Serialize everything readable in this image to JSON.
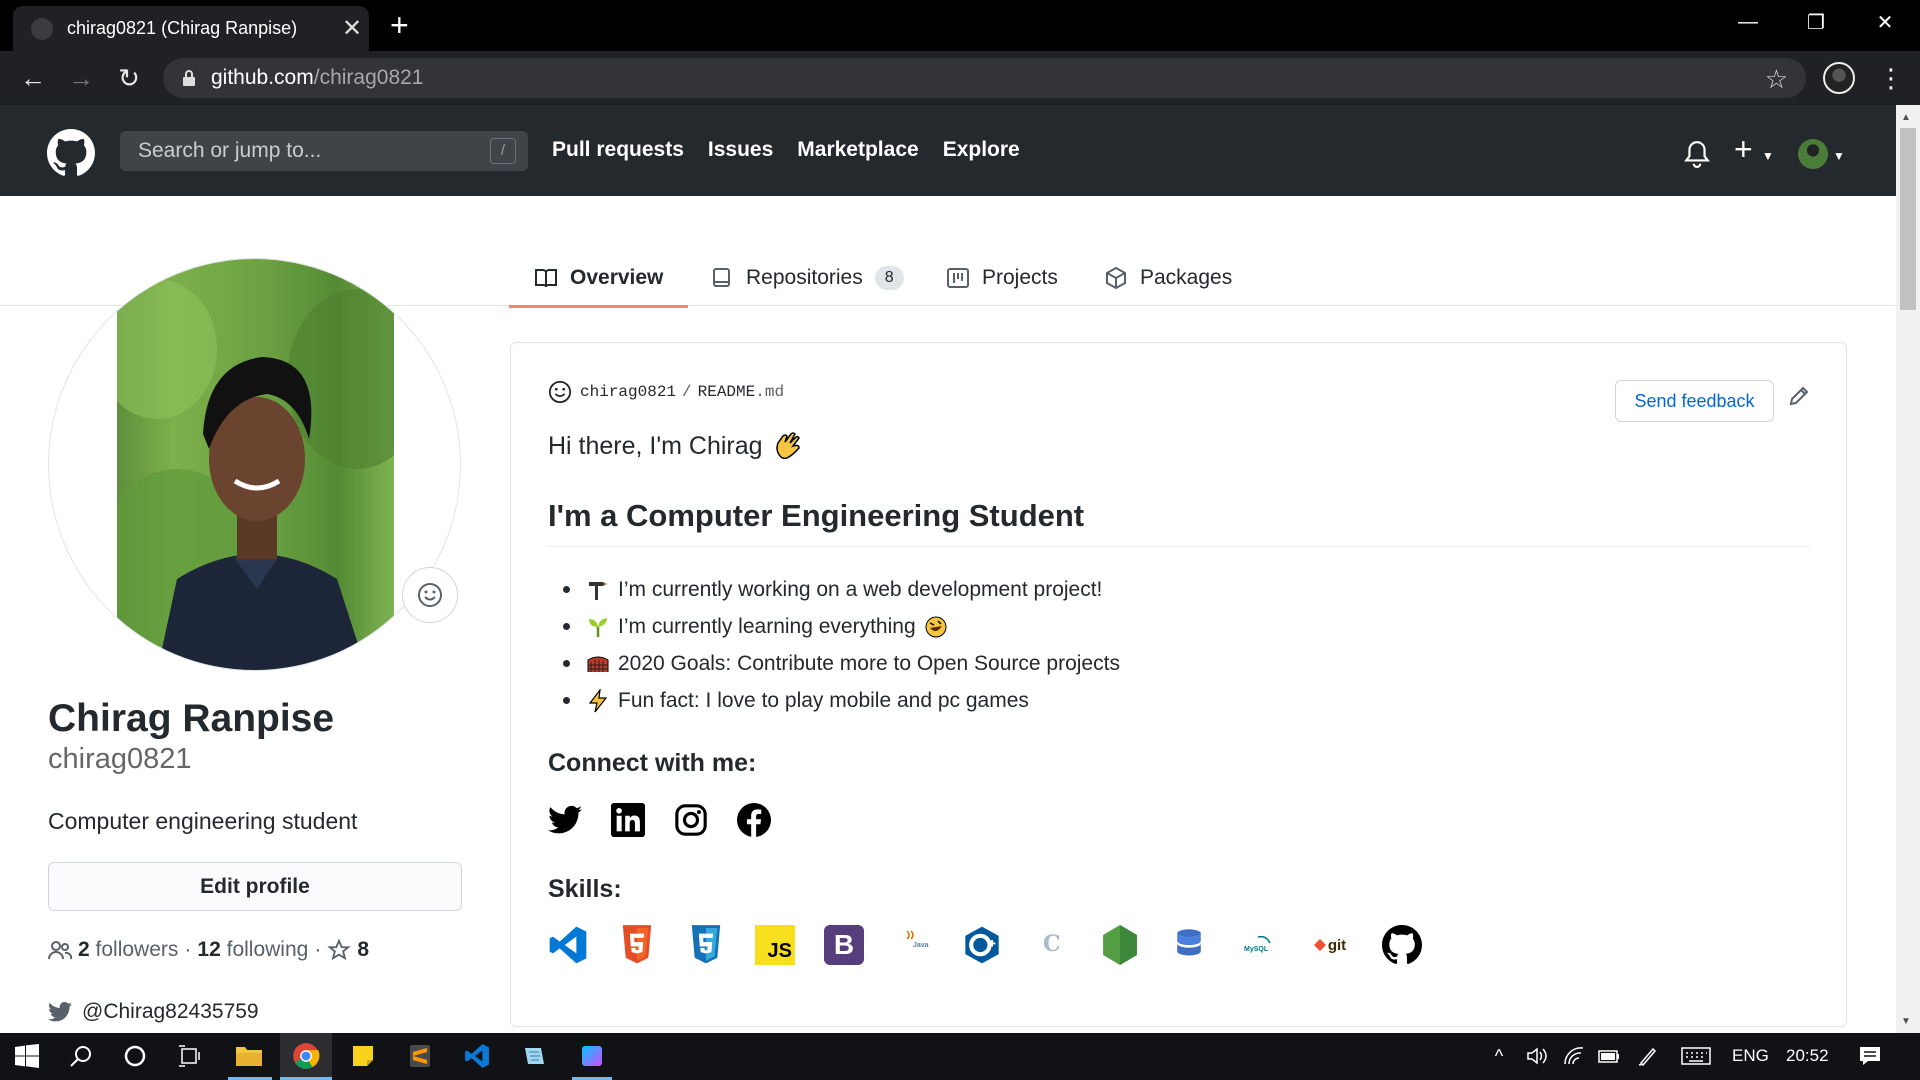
{
  "browser": {
    "tab_title": "chirag0821 (Chirag Ranpise)",
    "url_host": "github.com",
    "url_path": "/chirag0821"
  },
  "gh_header": {
    "search_placeholder": "Search or jump to...",
    "slash_key": "/",
    "nav": [
      "Pull requests",
      "Issues",
      "Marketplace",
      "Explore"
    ]
  },
  "profile_tabs": {
    "overview": "Overview",
    "repositories": "Repositories",
    "repositories_count": "8",
    "projects": "Projects",
    "packages": "Packages"
  },
  "profile": {
    "full_name": "Chirag Ranpise",
    "login": "chirag0821",
    "bio": "Computer engineering student",
    "edit_button": "Edit profile",
    "followers_count": "2",
    "followers_label": "followers",
    "following_count": "12",
    "following_label": "following",
    "stars_count": "8",
    "twitter": "@Chirag82435759"
  },
  "readme": {
    "owner": "chirag0821",
    "separator": "/",
    "file_name": "README",
    "file_ext": ".md",
    "feedback_button": "Send feedback",
    "greeting": "Hi there, I'm Chirag",
    "heading": "I'm a Computer Engineering Student",
    "bullets": [
      "I’m currently working on a web development project!",
      "I’m currently learning everything",
      "2020 Goals: Contribute more to Open Source projects",
      "Fun fact: I love to play mobile and pc games"
    ],
    "connect_heading": "Connect with me:",
    "skills_heading": "Skills:",
    "skill_js": "JS",
    "skill_git": "git"
  },
  "taskbar": {
    "language": "ENG",
    "time": "20:52"
  },
  "colors": {
    "gh_header_bg": "#24292e",
    "tab_underline": "#f9826c",
    "link_blue": "#0366d6"
  }
}
